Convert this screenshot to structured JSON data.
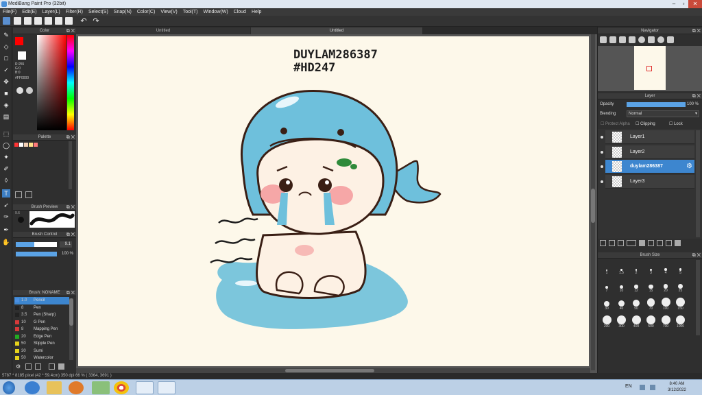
{
  "window": {
    "title": "MediBang Paint Pro (32bit)"
  },
  "menu": [
    "File(F)",
    "Edit(E)",
    "Layer(L)",
    "Filter(R)",
    "Select(S)",
    "Snap(N)",
    "Color(C)",
    "View(V)",
    "Tool(T)",
    "Window(W)",
    "Cloud",
    "Help"
  ],
  "tabs": [
    "Untitled",
    "Untitled"
  ],
  "color_panel": {
    "title": "Color",
    "rgb": [
      "R:255",
      "G:0",
      "B:0"
    ],
    "hex": "#FF0000",
    "primary_color": "#ff0000",
    "secondary_color": "#ffffff"
  },
  "palette_panel": {
    "title": "Palette",
    "colors": [
      "#ff3333",
      "#ffffff",
      "#f4d0b5",
      "#ffe28a",
      "#ff7a7a"
    ]
  },
  "brush_preview": {
    "title": "Brush Preview",
    "size": "9.6"
  },
  "brush_control": {
    "title": "Brush Control",
    "size_value": "9.1",
    "opacity_value": "100 %",
    "size_fraction": 0.45,
    "opacity_fraction": 1.0
  },
  "brush_list": {
    "title": "Brush: NONAME",
    "items": [
      {
        "size": "1.0",
        "name": "Pencil",
        "color": "#4b8fe0"
      },
      {
        "size": "8",
        "name": "Pen",
        "color": "#222222"
      },
      {
        "size": "3.5",
        "name": "Pen (Sharp)",
        "color": "#222222"
      },
      {
        "size": "10",
        "name": "G Pen",
        "color": "#d63a3a"
      },
      {
        "size": "8",
        "name": "Mapping Pen",
        "color": "#d63a3a"
      },
      {
        "size": "20",
        "name": "Edge Pen",
        "color": "#22aa22"
      },
      {
        "size": "50",
        "name": "Stipple Pen",
        "color": "#e6d21c"
      },
      {
        "size": "30",
        "name": "Sumi",
        "color": "#e6d21c"
      },
      {
        "size": "50",
        "name": "Watercolor",
        "color": "#e6d21c"
      }
    ]
  },
  "canvas": {
    "text_line1": "DUYLAM286387",
    "text_line2": "#HD247"
  },
  "navigator": {
    "title": "Navigator"
  },
  "layer_panel": {
    "title": "Layer",
    "opacity_label": "Opacity",
    "opacity_value": "100 %",
    "opacity_fraction": 1.0,
    "blending_label": "Blending",
    "blending_value": "Normal",
    "protect_alpha": "Protect Alpha",
    "clipping": "Clipping",
    "lock": "Lock",
    "layers": [
      {
        "name": "Layer1",
        "selected": false
      },
      {
        "name": "Layer2",
        "selected": false
      },
      {
        "name": "duylam286387",
        "selected": true
      },
      {
        "name": "Layer3",
        "selected": false
      }
    ]
  },
  "brush_size_panel": {
    "title": "Brush Size",
    "sizes": [
      "1",
      "1.5",
      "2",
      "3",
      "4",
      "5",
      "7",
      "10",
      "12",
      "15",
      "20",
      "25",
      "30",
      "40",
      "50",
      "70",
      "100",
      "150",
      "200",
      "300",
      "400",
      "500",
      "700",
      "1000"
    ]
  },
  "status": {
    "text": "5787 * 8185 pixel  (42 * 59.4cm)  350 dpi  66 %  ( 3364, 3691 )"
  },
  "taskbar": {
    "lang": "EN",
    "time": "8:40 AM",
    "date": "3/12/2022"
  }
}
